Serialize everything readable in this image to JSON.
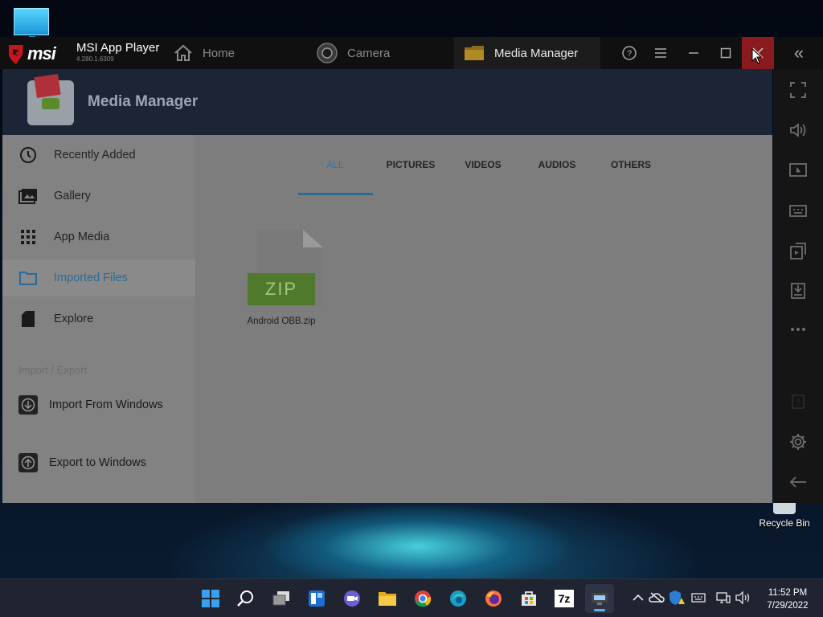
{
  "desktop": {
    "recycle_bin_label": "Recycle Bin"
  },
  "titlebar": {
    "brand": "msi",
    "app_name": "MSI App Player",
    "app_version": "4.280.1.6309",
    "tabs": [
      {
        "label": "Home",
        "icon": "home-icon"
      },
      {
        "label": "Camera",
        "icon": "camera-icon"
      },
      {
        "label": "Media Manager",
        "icon": "folder-icon",
        "active": true
      }
    ]
  },
  "side_toolbar": {
    "icons": [
      "fullscreen-icon",
      "volume-icon",
      "screen-record-icon",
      "keyboard-icon",
      "install-apk-icon",
      "screenshot-icon",
      "more-icon",
      "help-icon",
      "settings-icon",
      "back-icon"
    ]
  },
  "media_manager": {
    "title": "Media Manager",
    "nav": [
      {
        "label": "Recently Added",
        "icon": "clock-icon"
      },
      {
        "label": "Gallery",
        "icon": "gallery-icon"
      },
      {
        "label": "App Media",
        "icon": "grid-icon"
      },
      {
        "label": "Imported Files",
        "icon": "folder-icon",
        "active": true
      },
      {
        "label": "Explore",
        "icon": "sd-card-icon"
      }
    ],
    "section_label": "Import / Export",
    "actions": [
      {
        "label": "Import From Windows",
        "icon": "import-icon"
      },
      {
        "label": "Export to Windows",
        "icon": "export-icon"
      }
    ],
    "filter_tabs": [
      {
        "label": "ALL",
        "active": true
      },
      {
        "label": "PICTURES"
      },
      {
        "label": "VIDEOS"
      },
      {
        "label": "AUDIOS"
      },
      {
        "label": "OTHERS"
      }
    ],
    "files": [
      {
        "badge": "ZIP",
        "name": "Android OBB.zip"
      }
    ]
  },
  "taskbar": {
    "apps": [
      "start-icon",
      "search-icon",
      "task-view-icon",
      "widgets-icon",
      "chat-icon",
      "file-explorer-icon",
      "chrome-icon",
      "edge-icon",
      "firefox-icon",
      "store-icon",
      "7zip-icon",
      "msi-app-player-icon"
    ],
    "seven_zip_label": "7z",
    "time": "11:52 PM",
    "date": "7/29/2022"
  },
  "colors": {
    "close_button": "#8b1a1f",
    "active_accent": "#2c77b5",
    "header_bg": "#1c2535"
  }
}
